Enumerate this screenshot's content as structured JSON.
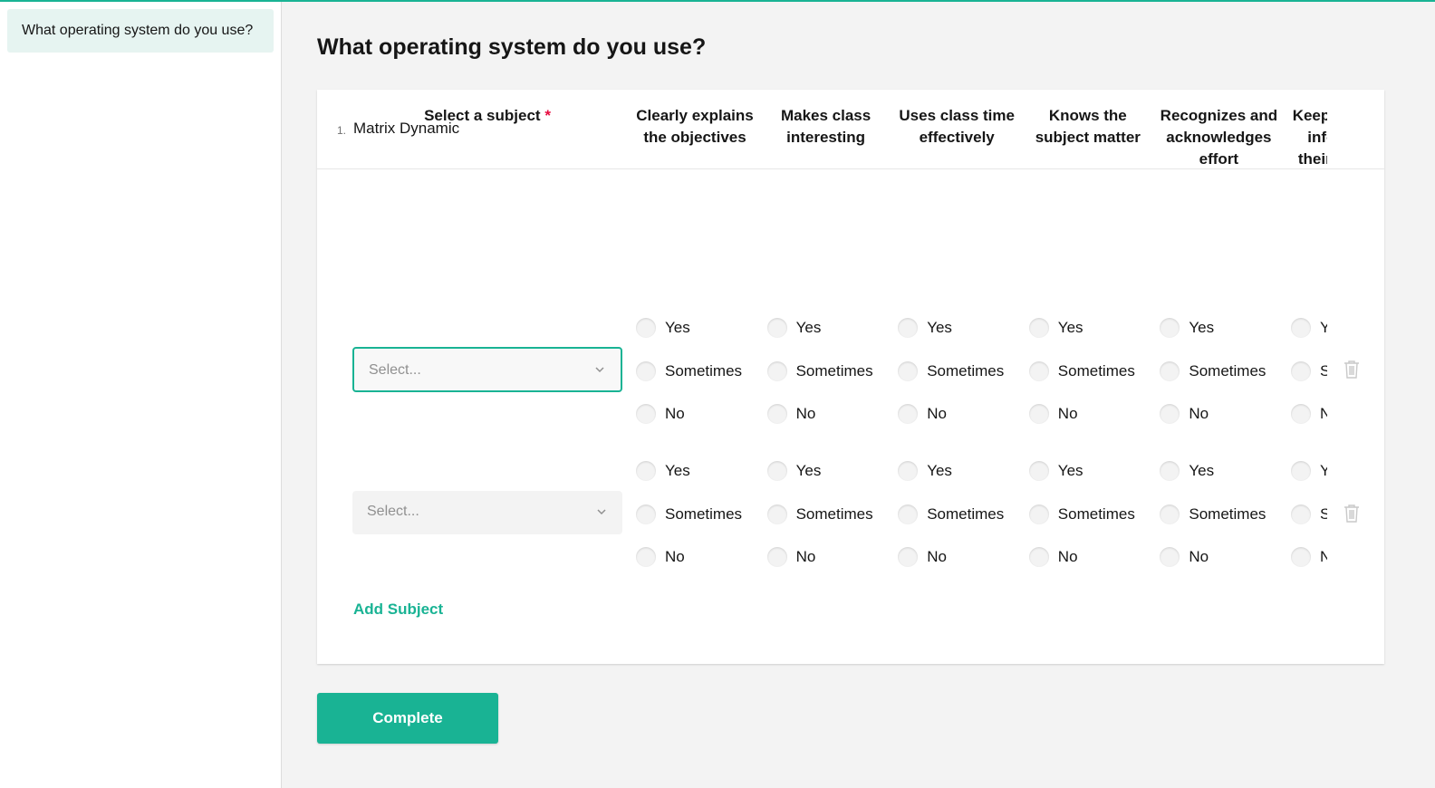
{
  "sidebar": {
    "items": [
      {
        "label": "What operating system do you use?"
      }
    ]
  },
  "page": {
    "title": "What operating system do you use?"
  },
  "question": {
    "number": "1.",
    "title": "Matrix Dynamic",
    "subject_column": {
      "label": "Select a subject",
      "required_mark": "*"
    },
    "columns": [
      {
        "label": "Clearly explains the objectives"
      },
      {
        "label": "Makes class interesting"
      },
      {
        "label": "Uses class time effectively"
      },
      {
        "label": "Knows the subject matter"
      },
      {
        "label": "Recognizes and acknowledges effort"
      },
      {
        "label": "Keeps students informed of their progress"
      }
    ],
    "choices": [
      "Yes",
      "Sometimes",
      "No"
    ],
    "rows": [
      {
        "placeholder": "Select...",
        "focused": true
      },
      {
        "placeholder": "Select...",
        "focused": false
      }
    ],
    "add_row_label": "Add Subject"
  },
  "actions": {
    "complete_label": "Complete"
  },
  "colors": {
    "accent": "#19b394",
    "required": "#e60a3e",
    "sidebar_active_bg": "#e6f4f1",
    "page_bg": "#f3f3f3"
  },
  "icons": {
    "dropdown": "chevron-down-icon",
    "remove_row": "trash-icon"
  }
}
